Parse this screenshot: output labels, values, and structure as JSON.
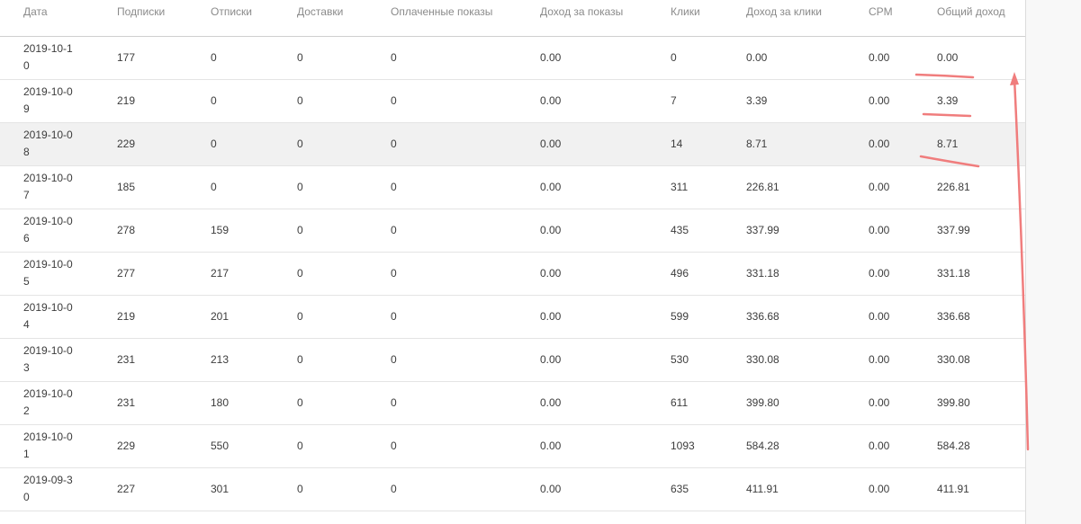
{
  "table": {
    "columns": [
      "Дата",
      "Подписки",
      "Отписки",
      "Доставки",
      "Оплаченные показы",
      "Доход за показы",
      "Клики",
      "Доход за клики",
      "CPM",
      "Общий доход"
    ],
    "rows": [
      [
        "2019-10-10",
        "177",
        "0",
        "0",
        "0",
        "0.00",
        "0",
        "0.00",
        "0.00",
        "0.00"
      ],
      [
        "2019-10-09",
        "219",
        "0",
        "0",
        "0",
        "0.00",
        "7",
        "3.39",
        "0.00",
        "3.39"
      ],
      [
        "2019-10-08",
        "229",
        "0",
        "0",
        "0",
        "0.00",
        "14",
        "8.71",
        "0.00",
        "8.71"
      ],
      [
        "2019-10-07",
        "185",
        "0",
        "0",
        "0",
        "0.00",
        "311",
        "226.81",
        "0.00",
        "226.81"
      ],
      [
        "2019-10-06",
        "278",
        "159",
        "0",
        "0",
        "0.00",
        "435",
        "337.99",
        "0.00",
        "337.99"
      ],
      [
        "2019-10-05",
        "277",
        "217",
        "0",
        "0",
        "0.00",
        "496",
        "331.18",
        "0.00",
        "331.18"
      ],
      [
        "2019-10-04",
        "219",
        "201",
        "0",
        "0",
        "0.00",
        "599",
        "336.68",
        "0.00",
        "336.68"
      ],
      [
        "2019-10-03",
        "231",
        "213",
        "0",
        "0",
        "0.00",
        "530",
        "330.08",
        "0.00",
        "330.08"
      ],
      [
        "2019-10-02",
        "231",
        "180",
        "0",
        "0",
        "0.00",
        "611",
        "399.80",
        "0.00",
        "399.80"
      ],
      [
        "2019-10-01",
        "229",
        "550",
        "0",
        "0",
        "0.00",
        "1093",
        "584.28",
        "0.00",
        "584.28"
      ],
      [
        "2019-09-30",
        "227",
        "301",
        "0",
        "0",
        "0.00",
        "635",
        "411.91",
        "0.00",
        "411.91"
      ]
    ]
  },
  "colors": {
    "header_text": "#8a8a8a",
    "cell_text": "#3c3c3c",
    "row_highlight": "#f1f1f1",
    "annotation": "#f07d7d"
  },
  "annotations": {
    "underline_icon": "red-underline",
    "arrow_icon": "red-up-arrow"
  }
}
